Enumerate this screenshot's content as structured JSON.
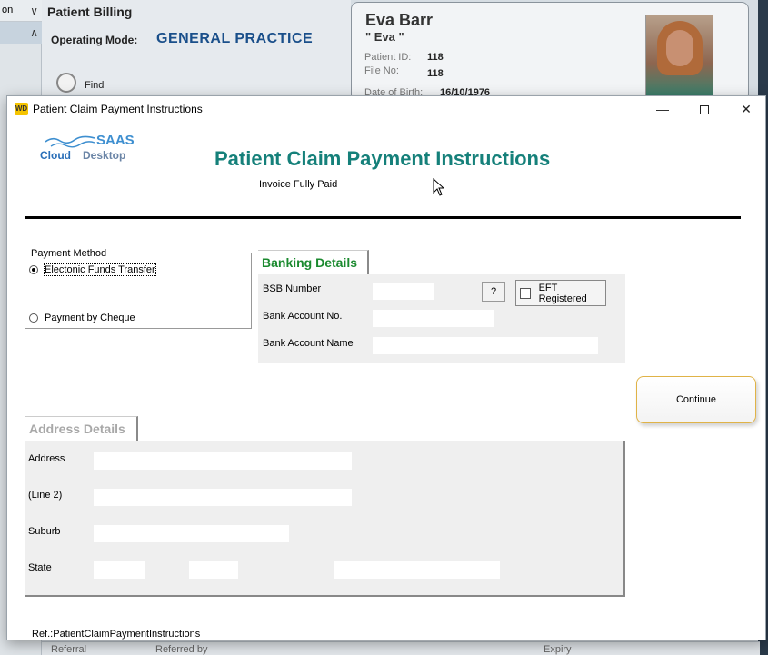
{
  "background": {
    "sidebar": {
      "top_text": "on",
      "chevrons": [
        "∨",
        "∧"
      ]
    },
    "title": "Patient Billing",
    "mode_label": "Operating Mode:",
    "mode_value": "GENERAL PRACTICE",
    "find_label": "Find",
    "patient": {
      "name": "Eva Barr",
      "nickname": "\" Eva \"",
      "id_label": "Patient ID:",
      "id_value": "118",
      "file_label": "File No:",
      "file_value": "118",
      "dob_label": "Date of Birth:",
      "dob_value": "16/10/1976"
    },
    "bottom": [
      "Referral",
      "Referred by",
      "Expiry"
    ]
  },
  "dialog": {
    "window_title": "Patient Claim Payment Instructions",
    "icon_text": "WD",
    "controls": {
      "minimize": "—",
      "close": "✕"
    },
    "logo": {
      "saas": "SAAS",
      "cloud": "Cloud",
      "desktop": "Desktop"
    },
    "title": "Patient Claim Payment Instructions",
    "subtitle": "Invoice Fully Paid",
    "payment_method": {
      "legend": "Payment Method",
      "options": [
        {
          "label": "Electonic Funds Transfer",
          "selected": true
        },
        {
          "label": "Payment by Cheque",
          "selected": false
        }
      ]
    },
    "banking": {
      "tab": "Banking Details",
      "bsb_label": "BSB Number",
      "bsb_value": "",
      "help_button": "?",
      "eft_label": "EFT Registered",
      "eft_checked": false,
      "account_no_label": "Bank Account No.",
      "account_no_value": "",
      "account_name_label": "Bank Account Name",
      "account_name_value": ""
    },
    "continue_button": "Continue",
    "address": {
      "tab": "Address Details",
      "address_label": "Address",
      "address_value": "",
      "line2_label": "(Line 2)",
      "line2_value": "",
      "suburb_label": "Suburb",
      "suburb_value": "",
      "state_label": "State",
      "state_value": "",
      "postcode_value": "",
      "country_value": ""
    },
    "ref": "Ref.:PatientClaimPaymentInstructions"
  }
}
